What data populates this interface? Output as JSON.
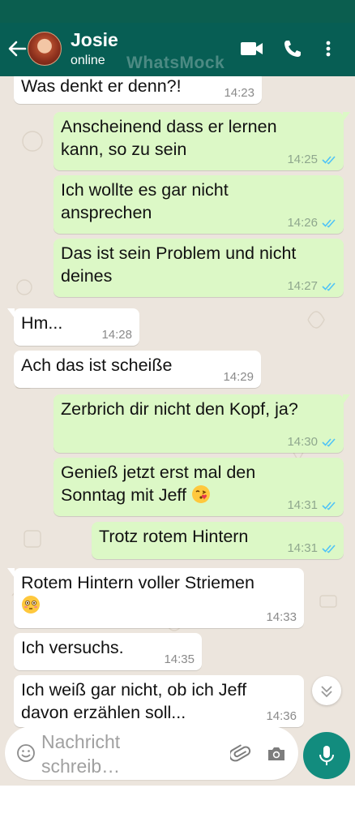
{
  "header": {
    "contact_name": "Josie",
    "contact_status": "online",
    "watermark": "WhatsMock",
    "icons": [
      "back-arrow-icon",
      "avatar",
      "video-call-icon",
      "voice-call-icon",
      "more-vert-icon"
    ]
  },
  "messages": [
    {
      "dir": "in",
      "text": "Was denkt er denn?!",
      "time": "14:23"
    },
    {
      "dir": "out",
      "text": "Anscheinend dass er lernen\nkann, so zu sein",
      "time": "14:25",
      "ticks": "read"
    },
    {
      "dir": "out",
      "text": "Ich wollte es gar nicht\nansprechen",
      "time": "14:26",
      "ticks": "read"
    },
    {
      "dir": "out",
      "text": "Das ist sein Problem und nicht\ndeines",
      "time": "14:27",
      "ticks": "read"
    },
    {
      "dir": "in",
      "text": "Hm...",
      "time": "14:28"
    },
    {
      "dir": "in",
      "text": "Ach das ist scheiße",
      "time": "14:29"
    },
    {
      "dir": "out",
      "text": "Zerbrich dir nicht den Kopf, ja?",
      "time": "14:30",
      "ticks": "read"
    },
    {
      "dir": "out",
      "text": "Genieß jetzt erst mal den\nSonntag mit Jeff",
      "time": "14:31",
      "ticks": "read",
      "emoji": "face-blowing-kiss"
    },
    {
      "dir": "out",
      "text": "Trotz rotem Hintern",
      "time": "14:31",
      "ticks": "read"
    },
    {
      "dir": "in",
      "text": "Rotem Hintern voller Striemen",
      "time": "14:33",
      "emoji_line": "flushed-face"
    },
    {
      "dir": "in",
      "text": "Ich versuchs.",
      "time": "14:35"
    },
    {
      "dir": "in",
      "text": "Ich weiß gar nicht, ob ich Jeff\ndavon erzählen soll...",
      "time": "14:36"
    }
  ],
  "composer": {
    "placeholder": "Nachricht\nschreib…",
    "icons": [
      "emoji-icon",
      "attach-icon",
      "camera-icon",
      "mic-icon"
    ]
  },
  "colors": {
    "header": "#075e54",
    "statusbar": "#0b5e4f",
    "chat_bg": "#ece5dd",
    "outgoing_bubble": "#dcf8c6",
    "incoming_bubble": "#ffffff",
    "read_ticks": "#4fc3f7",
    "mic_button": "#128c7e"
  }
}
